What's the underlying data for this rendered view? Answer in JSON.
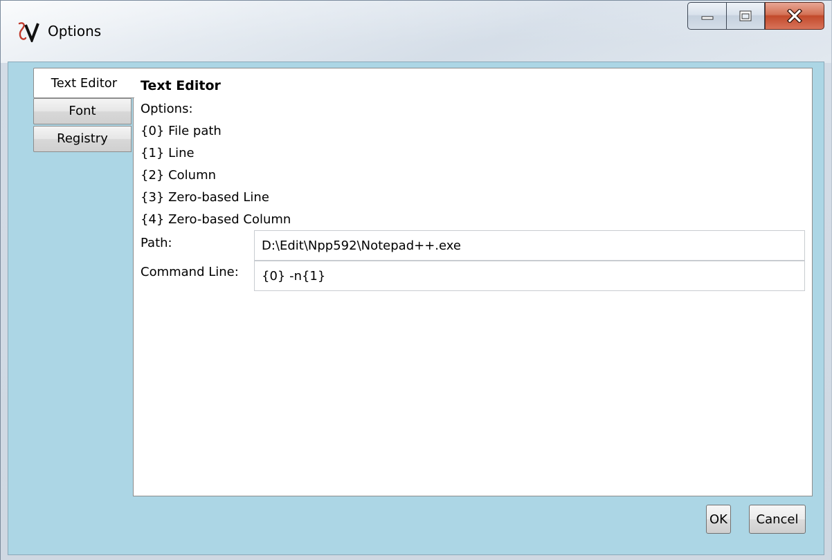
{
  "window": {
    "title": "Options",
    "controls": {
      "minimize": "minimize-icon",
      "maximize": "maximize-icon",
      "close": "close-icon"
    }
  },
  "tabs": [
    {
      "label": "Text Editor",
      "active": true
    },
    {
      "label": "Font",
      "active": false
    },
    {
      "label": "Registry",
      "active": false
    }
  ],
  "panel": {
    "title": "Text Editor",
    "options_heading": "Options:",
    "options": [
      "{0} File path",
      "{1} Line",
      "{2} Column",
      "{3} Zero-based Line",
      "{4} Zero-based Column"
    ],
    "path_label": "Path:",
    "path_value": "D:\\Edit\\Npp592\\Notepad++.exe",
    "command_label": "Command Line:",
    "command_value": "{0} -n{1}"
  },
  "buttons": {
    "ok": "OK",
    "cancel": "Cancel"
  },
  "colors": {
    "client_background": "#acd6e5",
    "close_button": "#c24a2b"
  }
}
